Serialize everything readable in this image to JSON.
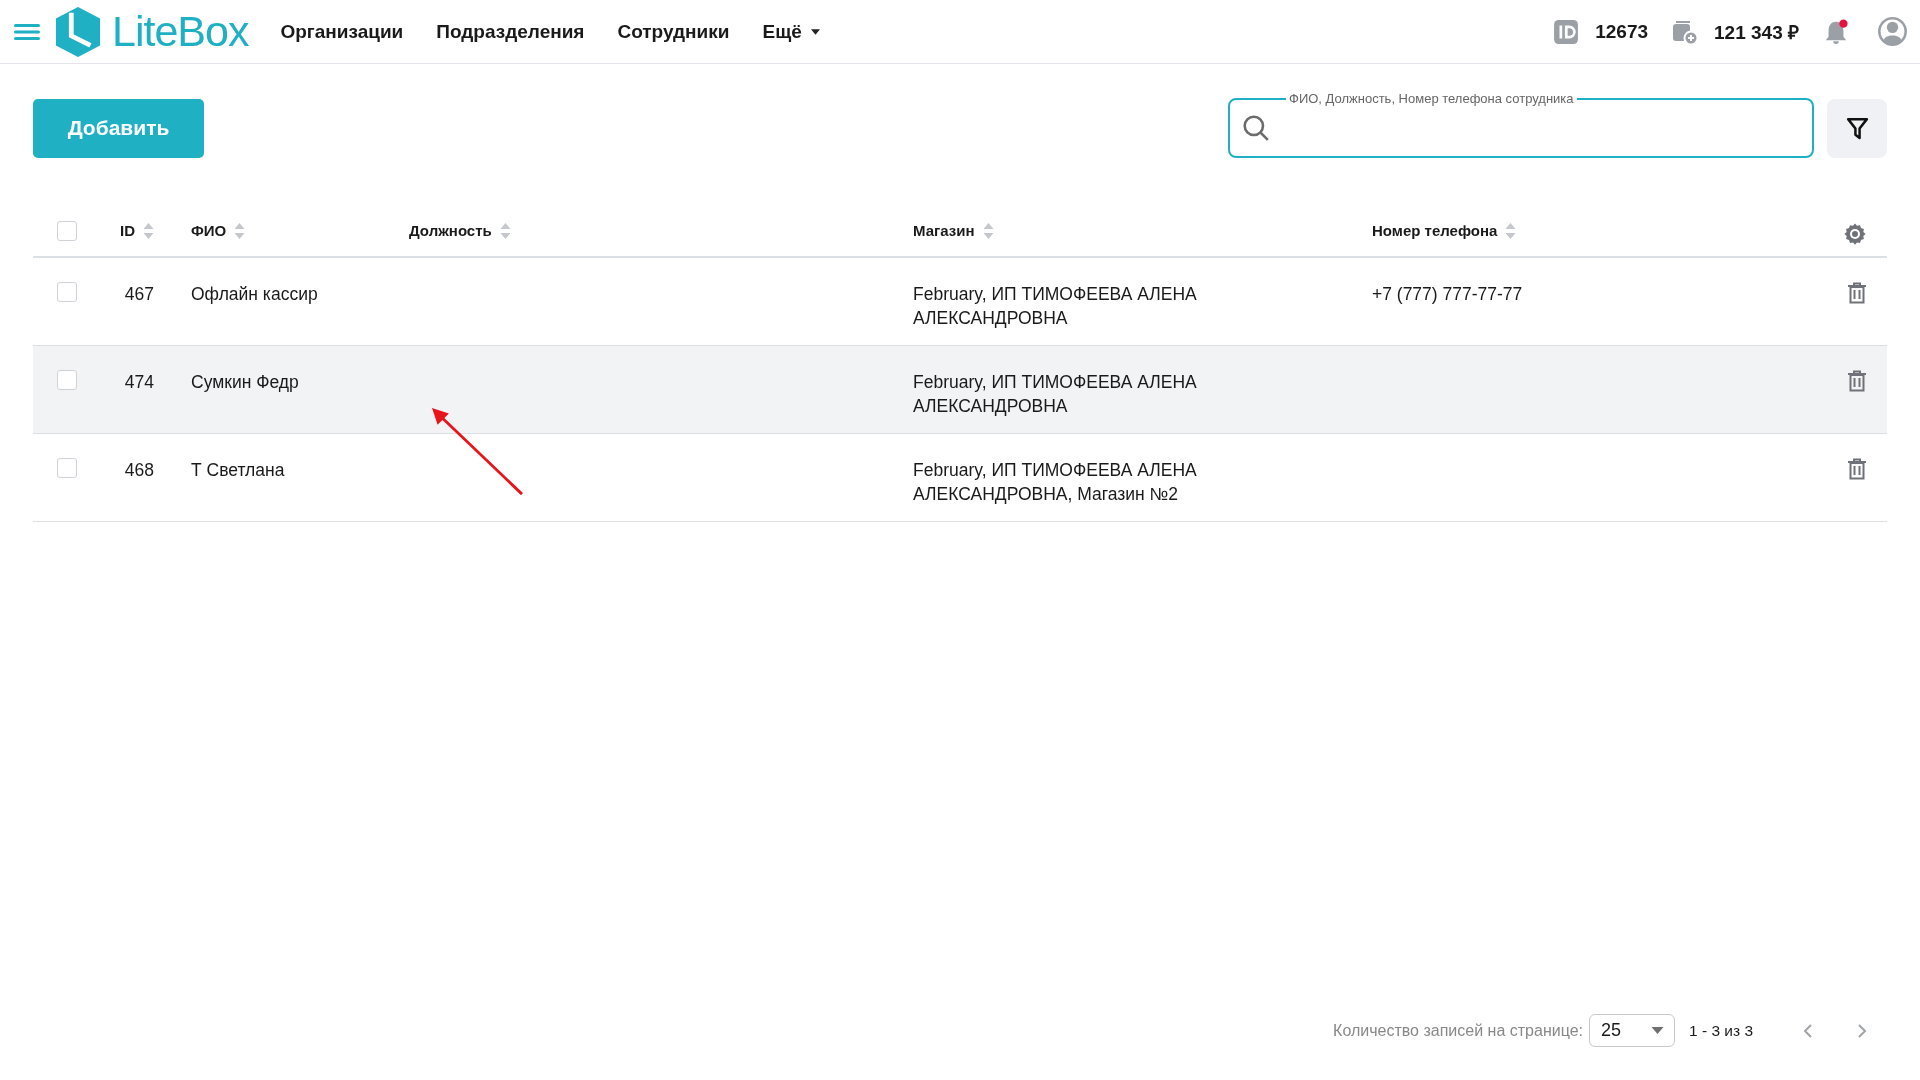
{
  "header": {
    "logo": "LiteBox",
    "nav": [
      {
        "label": "Организации",
        "dropdown": false
      },
      {
        "label": "Подразделения",
        "dropdown": false
      },
      {
        "label": "Сотрудники",
        "dropdown": false
      },
      {
        "label": "Ещё",
        "dropdown": true
      }
    ],
    "account_id": "12673",
    "balance": "121 343 ₽",
    "has_notifications": true
  },
  "toolbar": {
    "add_button": "Добавить",
    "search": {
      "label": "ФИО, Должность, Номер телефона сотрудника"
    }
  },
  "table": {
    "select_all_checked": false,
    "columns": [
      "ID",
      "ФИО",
      "Должность",
      "Магазин",
      "Номер телефона"
    ],
    "rows": [
      {
        "id": "467",
        "name": "Офлайн кассир",
        "store": "February, ИП ТИМОФЕЕВА АЛЕНА АЛЕКСАНДРОВНА",
        "phone": "+7 (777) 777-77-77",
        "checked": false,
        "highlighted": false
      },
      {
        "id": "474",
        "name": "Сумкин Федр",
        "store": "February, ИП ТИМОФЕЕВА АЛЕНА АЛЕКСАНДРОВНА",
        "checked": false,
        "highlighted": true
      },
      {
        "id": "468",
        "name": "Т Светлана",
        "store": "February, ИП ТИМОФЕЕВА АЛЕНА АЛЕКСАНДРОВНА, Магазин №2",
        "checked": false,
        "highlighted": false
      }
    ]
  },
  "pagination": {
    "per_page_label": "Количество записей на странице:",
    "per_page": "25",
    "range": "1 - 3 из 3"
  }
}
